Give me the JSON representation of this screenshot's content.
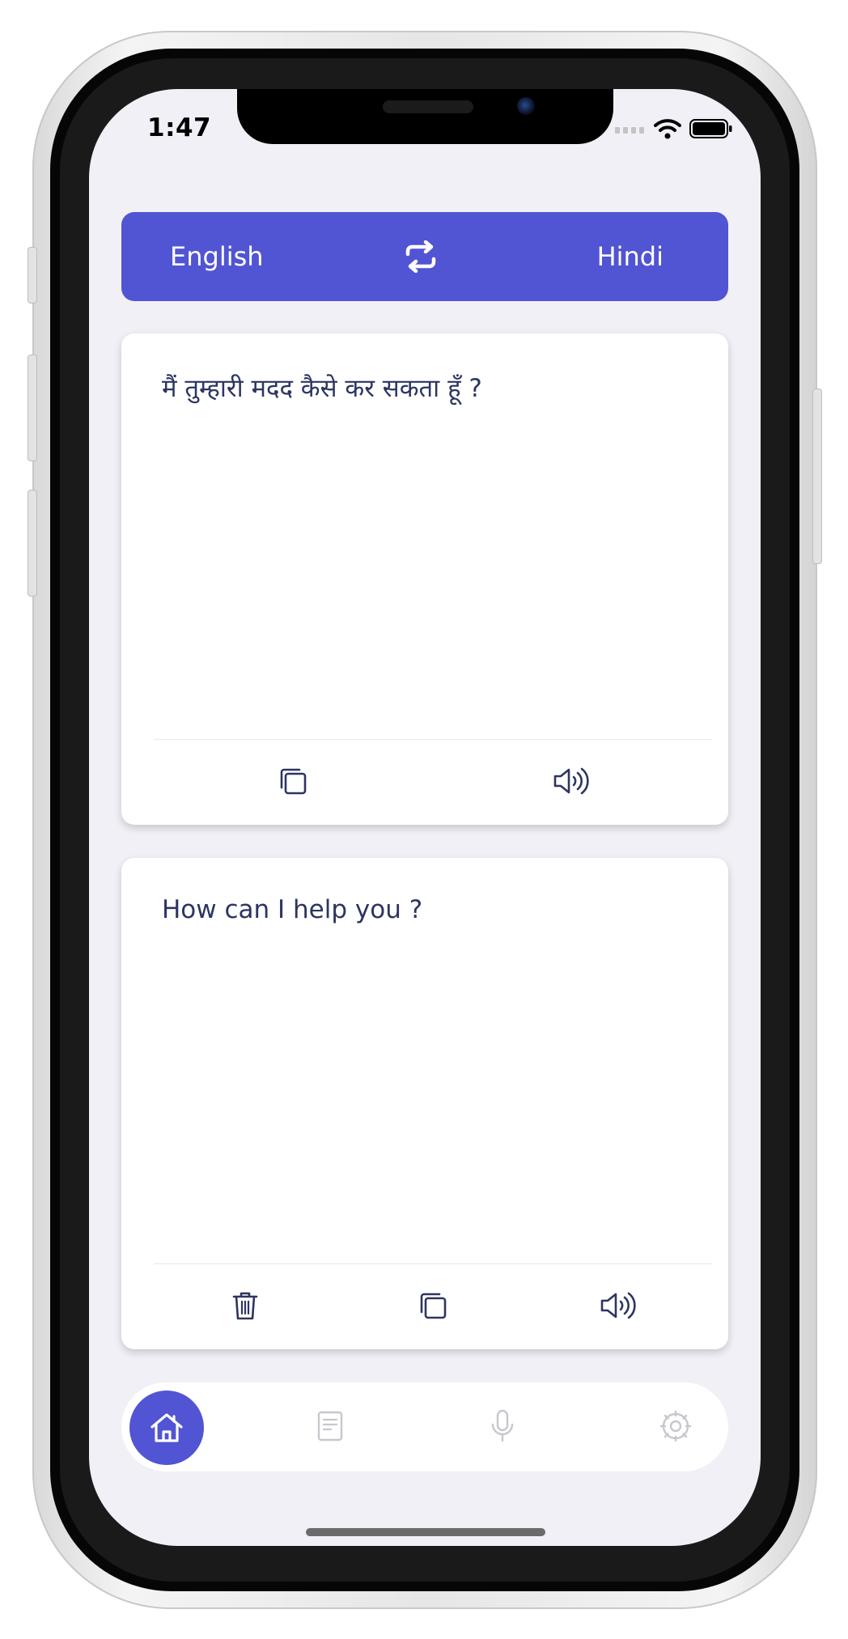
{
  "status_bar": {
    "time": "1:47"
  },
  "language_bar": {
    "source": "English",
    "target": "Hindi",
    "swap_icon": "swap-icon"
  },
  "source_card": {
    "text": "मैं तुम्हारी मदद कैसे कर सकता हूँ ?",
    "actions": [
      "copy-icon",
      "speaker-icon"
    ]
  },
  "target_card": {
    "text": "How can I help you ?",
    "actions": [
      "trash-icon",
      "copy-icon",
      "speaker-icon"
    ]
  },
  "bottom_nav": {
    "items": [
      "home-icon",
      "document-icon",
      "microphone-icon",
      "settings-icon"
    ],
    "active": "home-icon"
  },
  "colors": {
    "accent": "#5154d3",
    "text": "#2d3561",
    "background": "#f1f0f7",
    "inactive_icon": "#c7c7cf"
  }
}
